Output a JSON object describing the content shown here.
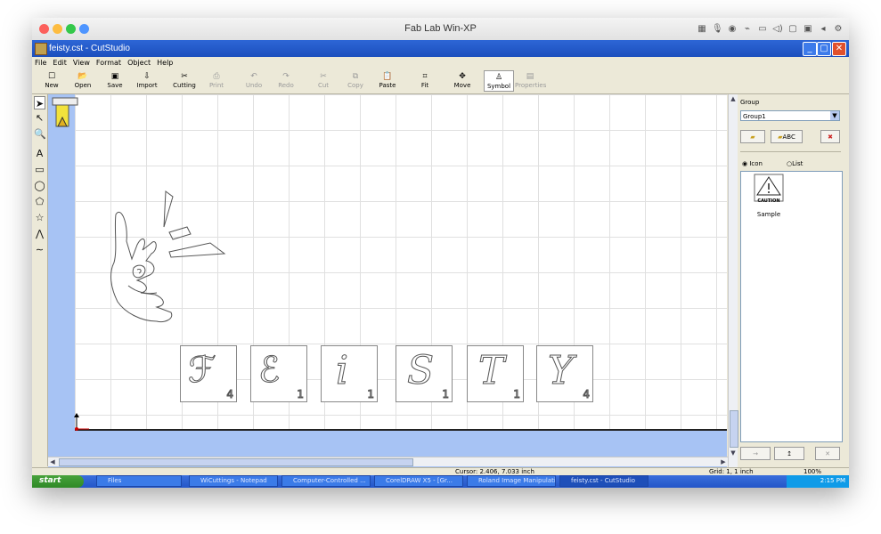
{
  "mac": {
    "title": "Fab Lab Win-XP",
    "dots": [
      "#fc605c",
      "#fdbc40",
      "#34c84a",
      "#4e95ff"
    ]
  },
  "window": {
    "title": "feisty.cst - CutStudio"
  },
  "menu": [
    "File",
    "Edit",
    "View",
    "Format",
    "Object",
    "Help"
  ],
  "toolbar": [
    {
      "label": "New",
      "icon": "☐",
      "enabled": true
    },
    {
      "label": "Open",
      "icon": "📂",
      "enabled": true
    },
    {
      "label": "Save",
      "icon": "▣",
      "enabled": true
    },
    {
      "label": "Import",
      "icon": "⇩",
      "enabled": true
    },
    {
      "label": "Cutting",
      "icon": "✂",
      "enabled": true
    },
    {
      "label": "Print",
      "icon": "⎙",
      "enabled": false
    },
    {
      "label": "Undo",
      "icon": "↶",
      "enabled": false
    },
    {
      "label": "Redo",
      "icon": "↷",
      "enabled": false
    },
    {
      "label": "Cut",
      "icon": "✂",
      "enabled": false
    },
    {
      "label": "Copy",
      "icon": "⧉",
      "enabled": false
    },
    {
      "label": "Paste",
      "icon": "📋",
      "enabled": true
    },
    {
      "label": "Fit",
      "icon": "⌗",
      "enabled": true
    },
    {
      "label": "Move",
      "icon": "✥",
      "enabled": true
    },
    {
      "label": "Symbol",
      "icon": "♙",
      "enabled": true,
      "active": true
    },
    {
      "label": "Properties",
      "icon": "▤",
      "enabled": false
    }
  ],
  "tools": [
    "➤",
    "↖",
    "🔍",
    "A",
    "▭",
    "◯",
    "⬠",
    "☆",
    "⋀",
    "∼"
  ],
  "panel": {
    "group_label": "Group",
    "group_value": "Group1",
    "abc_label": "ABC",
    "radio_icon": "Icon",
    "radio_list": "List",
    "symbol_caption": "CAUTION",
    "symbol_name": "Sample"
  },
  "letters": [
    {
      "glyph": "ℱ",
      "num": "4"
    },
    {
      "glyph": "ℰ",
      "num": "1"
    },
    {
      "glyph": "i",
      "num": "1"
    },
    {
      "glyph": "S",
      "num": "1"
    },
    {
      "glyph": "T",
      "num": "1"
    },
    {
      "glyph": "Y",
      "num": "4"
    }
  ],
  "status": {
    "cursor": "Cursor: 2.406, 7.033 inch",
    "grid": "Grid: 1, 1 inch",
    "zoom": "100%"
  },
  "taskbar": {
    "start": "start",
    "tasks": [
      "Files",
      "WiCuttings - Notepad",
      "Computer-Controlled ...",
      "CorelDRAW X5 - [Gr...",
      "Roland Image Manipulati...",
      "feisty.cst - CutStudio"
    ],
    "clock": "2:15 PM"
  }
}
